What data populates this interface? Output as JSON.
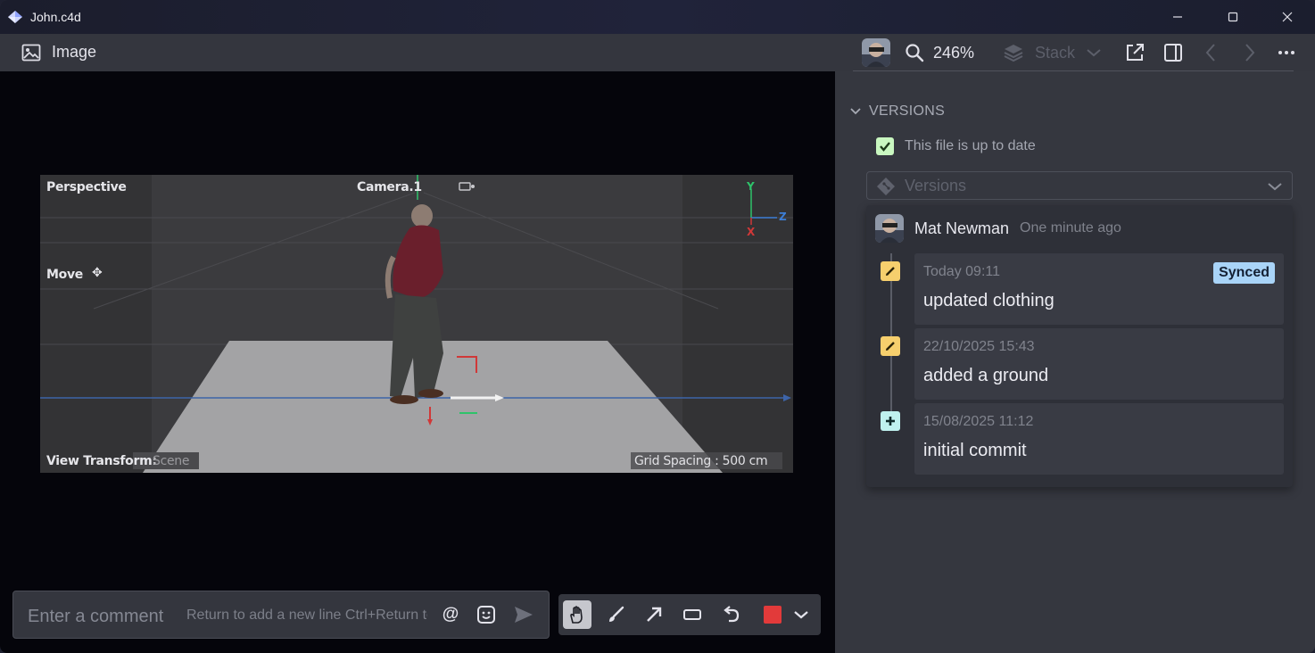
{
  "window": {
    "title": "John.c4d"
  },
  "toolbar": {
    "view_label": "Image",
    "zoom": "246%",
    "stack_label": "Stack"
  },
  "render": {
    "viewport_label": "Perspective",
    "camera_label": "Camera.1",
    "tool_label": "Move",
    "transform_label": "View Transform:",
    "transform_value": "Scene",
    "grid_spacing": "Grid Spacing : 500 cm",
    "axis_y": "Y",
    "axis_z": "Z",
    "axis_x": "X"
  },
  "comment": {
    "placeholder": "Enter a comment",
    "hint": "Return to add a new line  Ctrl+Return to send"
  },
  "annotation": {
    "color": "#e23a3a"
  },
  "versions": {
    "section_title": "VERSIONS",
    "status": "This file is up to date",
    "select_placeholder": "Versions",
    "author": "Mat Newman",
    "time_ago": "One minute ago",
    "entries": [
      {
        "timestamp": "Today 09:11",
        "message": "updated clothing",
        "badge": "Synced",
        "kind": "edit"
      },
      {
        "timestamp": "22/10/2025 15:43",
        "message": "added a ground",
        "kind": "edit"
      },
      {
        "timestamp": "15/08/2025 11:12",
        "message": "initial commit",
        "kind": "add"
      }
    ]
  }
}
